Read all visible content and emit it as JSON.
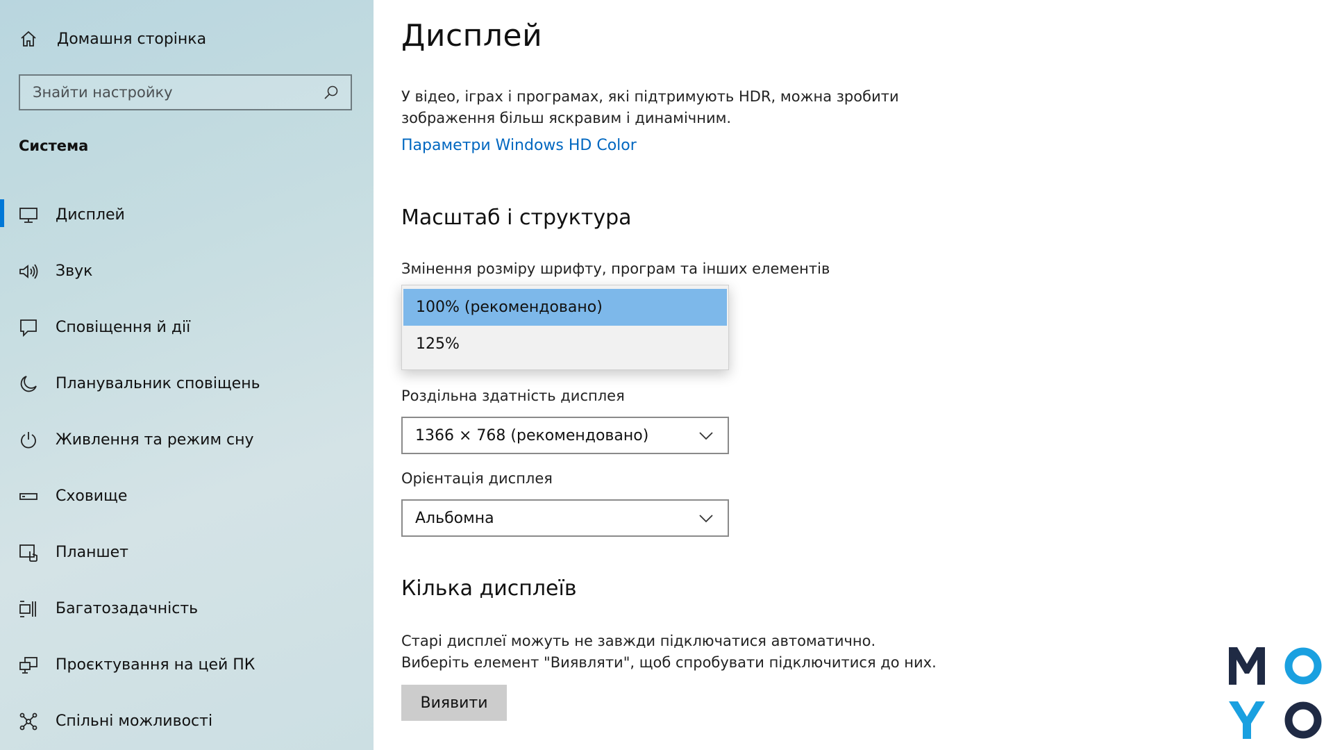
{
  "sidebar": {
    "home_label": "Домашня сторінка",
    "search_placeholder": "Знайти настройку",
    "section_title": "Система",
    "items": [
      {
        "label": "Дисплей",
        "icon": "monitor-icon",
        "active": true
      },
      {
        "label": "Звук",
        "icon": "speaker-icon"
      },
      {
        "label": "Сповіщення й дії",
        "icon": "notification-icon"
      },
      {
        "label": "Планувальник сповіщень",
        "icon": "moon-icon"
      },
      {
        "label": "Живлення та режим сну",
        "icon": "power-icon"
      },
      {
        "label": "Сховище",
        "icon": "storage-icon"
      },
      {
        "label": "Планшет",
        "icon": "tablet-icon"
      },
      {
        "label": "Багатозадачність",
        "icon": "multitasking-icon"
      },
      {
        "label": "Проєктування на цей ПК",
        "icon": "projecting-icon"
      },
      {
        "label": "Спільні можливості",
        "icon": "shared-experiences-icon"
      }
    ]
  },
  "main": {
    "title": "Дисплей",
    "hdr": {
      "description": "У відео, іграх і програмах, які підтримують HDR, можна зробити зображення більш яскравим і динамічним.",
      "link": "Параметри Windows HD Color"
    },
    "scale": {
      "heading": "Масштаб і структура",
      "scale_label": "Змінення розміру шрифту, програм та інших елементів",
      "scale_options": [
        "100% (рекомендовано)",
        "125%"
      ],
      "resolution_label": "Роздільна здатність дисплея",
      "resolution_value": "1366 × 768 (рекомендовано)",
      "orientation_label": "Орієнтація дисплея",
      "orientation_value": "Альбомна"
    },
    "multi": {
      "heading": "Кілька дисплеїв",
      "description_line1": "Старі дисплеї можуть не завжди підключатися автоматично.",
      "description_line2": "Виберіть елемент \"Виявляти\", щоб спробувати підключитися до них.",
      "button": "Виявити"
    }
  },
  "logo": {
    "letters": [
      "M",
      "O",
      "Y",
      "O"
    ],
    "colors": {
      "dark": "#1f2a44",
      "accent": "#1aa0e0"
    }
  },
  "colors": {
    "accent": "#0078d7",
    "link": "#0067c0",
    "selected_option": "#7db8ea"
  }
}
